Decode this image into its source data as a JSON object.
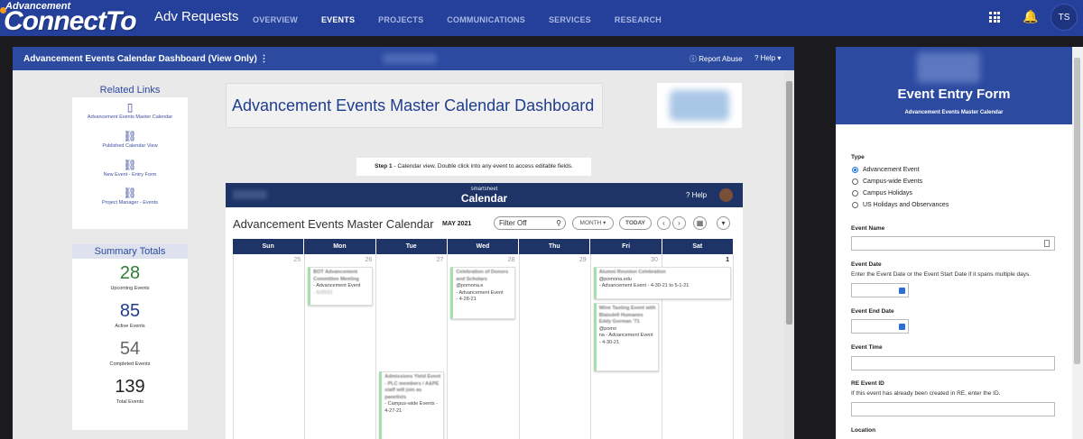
{
  "topbar": {
    "logo_top": "Advancement",
    "logo_main": "ConnectTo",
    "app_title": "Adv Requests",
    "nav": [
      "OVERVIEW",
      "EVENTS",
      "PROJECTS",
      "COMMUNICATIONS",
      "SERVICES",
      "RESEARCH"
    ],
    "active_nav": "EVENTS",
    "avatar_initials": "TS"
  },
  "dashboard": {
    "title": "Advancement Events Calendar Dashboard (View Only) ⋮",
    "report_abuse": "Report Abuse",
    "help": "Help",
    "related_links": {
      "title": "Related Links",
      "items": [
        {
          "icon": "document-icon",
          "label": "Advancement Events Master Calendar"
        },
        {
          "icon": "link-icon",
          "label": "Published Calendar View"
        },
        {
          "icon": "link-icon",
          "label": "New Event - Entry Form"
        },
        {
          "icon": "link-icon",
          "label": "Project Manager - Events"
        }
      ]
    },
    "summary": {
      "title": "Summary Totals",
      "metrics": [
        {
          "value": "28",
          "label": "Upcoming Events",
          "color": "#2e7d32"
        },
        {
          "value": "85",
          "label": "Active Events",
          "color": "#1f3d8f"
        },
        {
          "value": "54",
          "label": "Completed Events",
          "color": "#666666"
        },
        {
          "value": "139",
          "label": "Total Events",
          "color": "#222222"
        }
      ]
    },
    "main_title": "Advancement Events Master Calendar Dashboard",
    "step_bold": "Step 1",
    "step_text": " - Calendar view. Double click into any event to access editable fields."
  },
  "calendar": {
    "brand_small": "smartsheet",
    "brand": "Calendar",
    "help": "Help",
    "title": "Advancement Events Master Calendar",
    "month": "MAY 2021",
    "filter": "Filter Off",
    "month_btn": "MONTH ▾",
    "today_btn": "TODAY",
    "prev": "‹",
    "next": "›",
    "days": [
      "Sun",
      "Mon",
      "Tue",
      "Wed",
      "Thu",
      "Fri",
      "Sat"
    ],
    "dates": [
      "25",
      "26",
      "27",
      "28",
      "29",
      "30",
      "1"
    ],
    "events": {
      "mon": {
        "title": "BOT Advancement Committee Meeting",
        "type": "- Advancement Event",
        "date": "- 5/20/21"
      },
      "wed": {
        "title": "Celebration of Donors and Scholars",
        "email": "@pomona.e",
        "type": "- Advancement Event",
        "date": "- 4-28-21"
      },
      "fri1": {
        "title": "Alumni Reunion Celebration",
        "email": "@pomona.edu",
        "type": "- Advancement Event - 4-30-21 to 5-1-21"
      },
      "fri2": {
        "title": "Wine Tasting Event with Blaisdell Humanes Eddy Gorman '71",
        "email": "@pomo",
        "type": "na - Advancement Event - 4-30-21"
      },
      "tue": {
        "title": "Admissions Yield Event - PLC members / A&PE staff will join as panelists",
        "type": "- Campus-wide Events - 4-27-21"
      }
    }
  },
  "form": {
    "title": "Event Entry Form",
    "subtitle": "Advancement Events Master Calendar",
    "type_label": "Type",
    "type_options": [
      "Advancement Event",
      "Campus-wide Events",
      "Campus Holidays",
      "US Holidays and Observances"
    ],
    "selected_type": "Advancement Event",
    "event_name_label": "Event Name",
    "event_date_label": "Event Date",
    "event_date_help": "Enter the Event Date or the Event Start Date if it spans multiple days.",
    "event_end_date_label": "Event End Date",
    "event_time_label": "Event Time",
    "re_event_id_label": "RE Event ID",
    "re_event_id_help": "If this event has already been created in RE, enter the ID.",
    "location_label": "Location"
  }
}
